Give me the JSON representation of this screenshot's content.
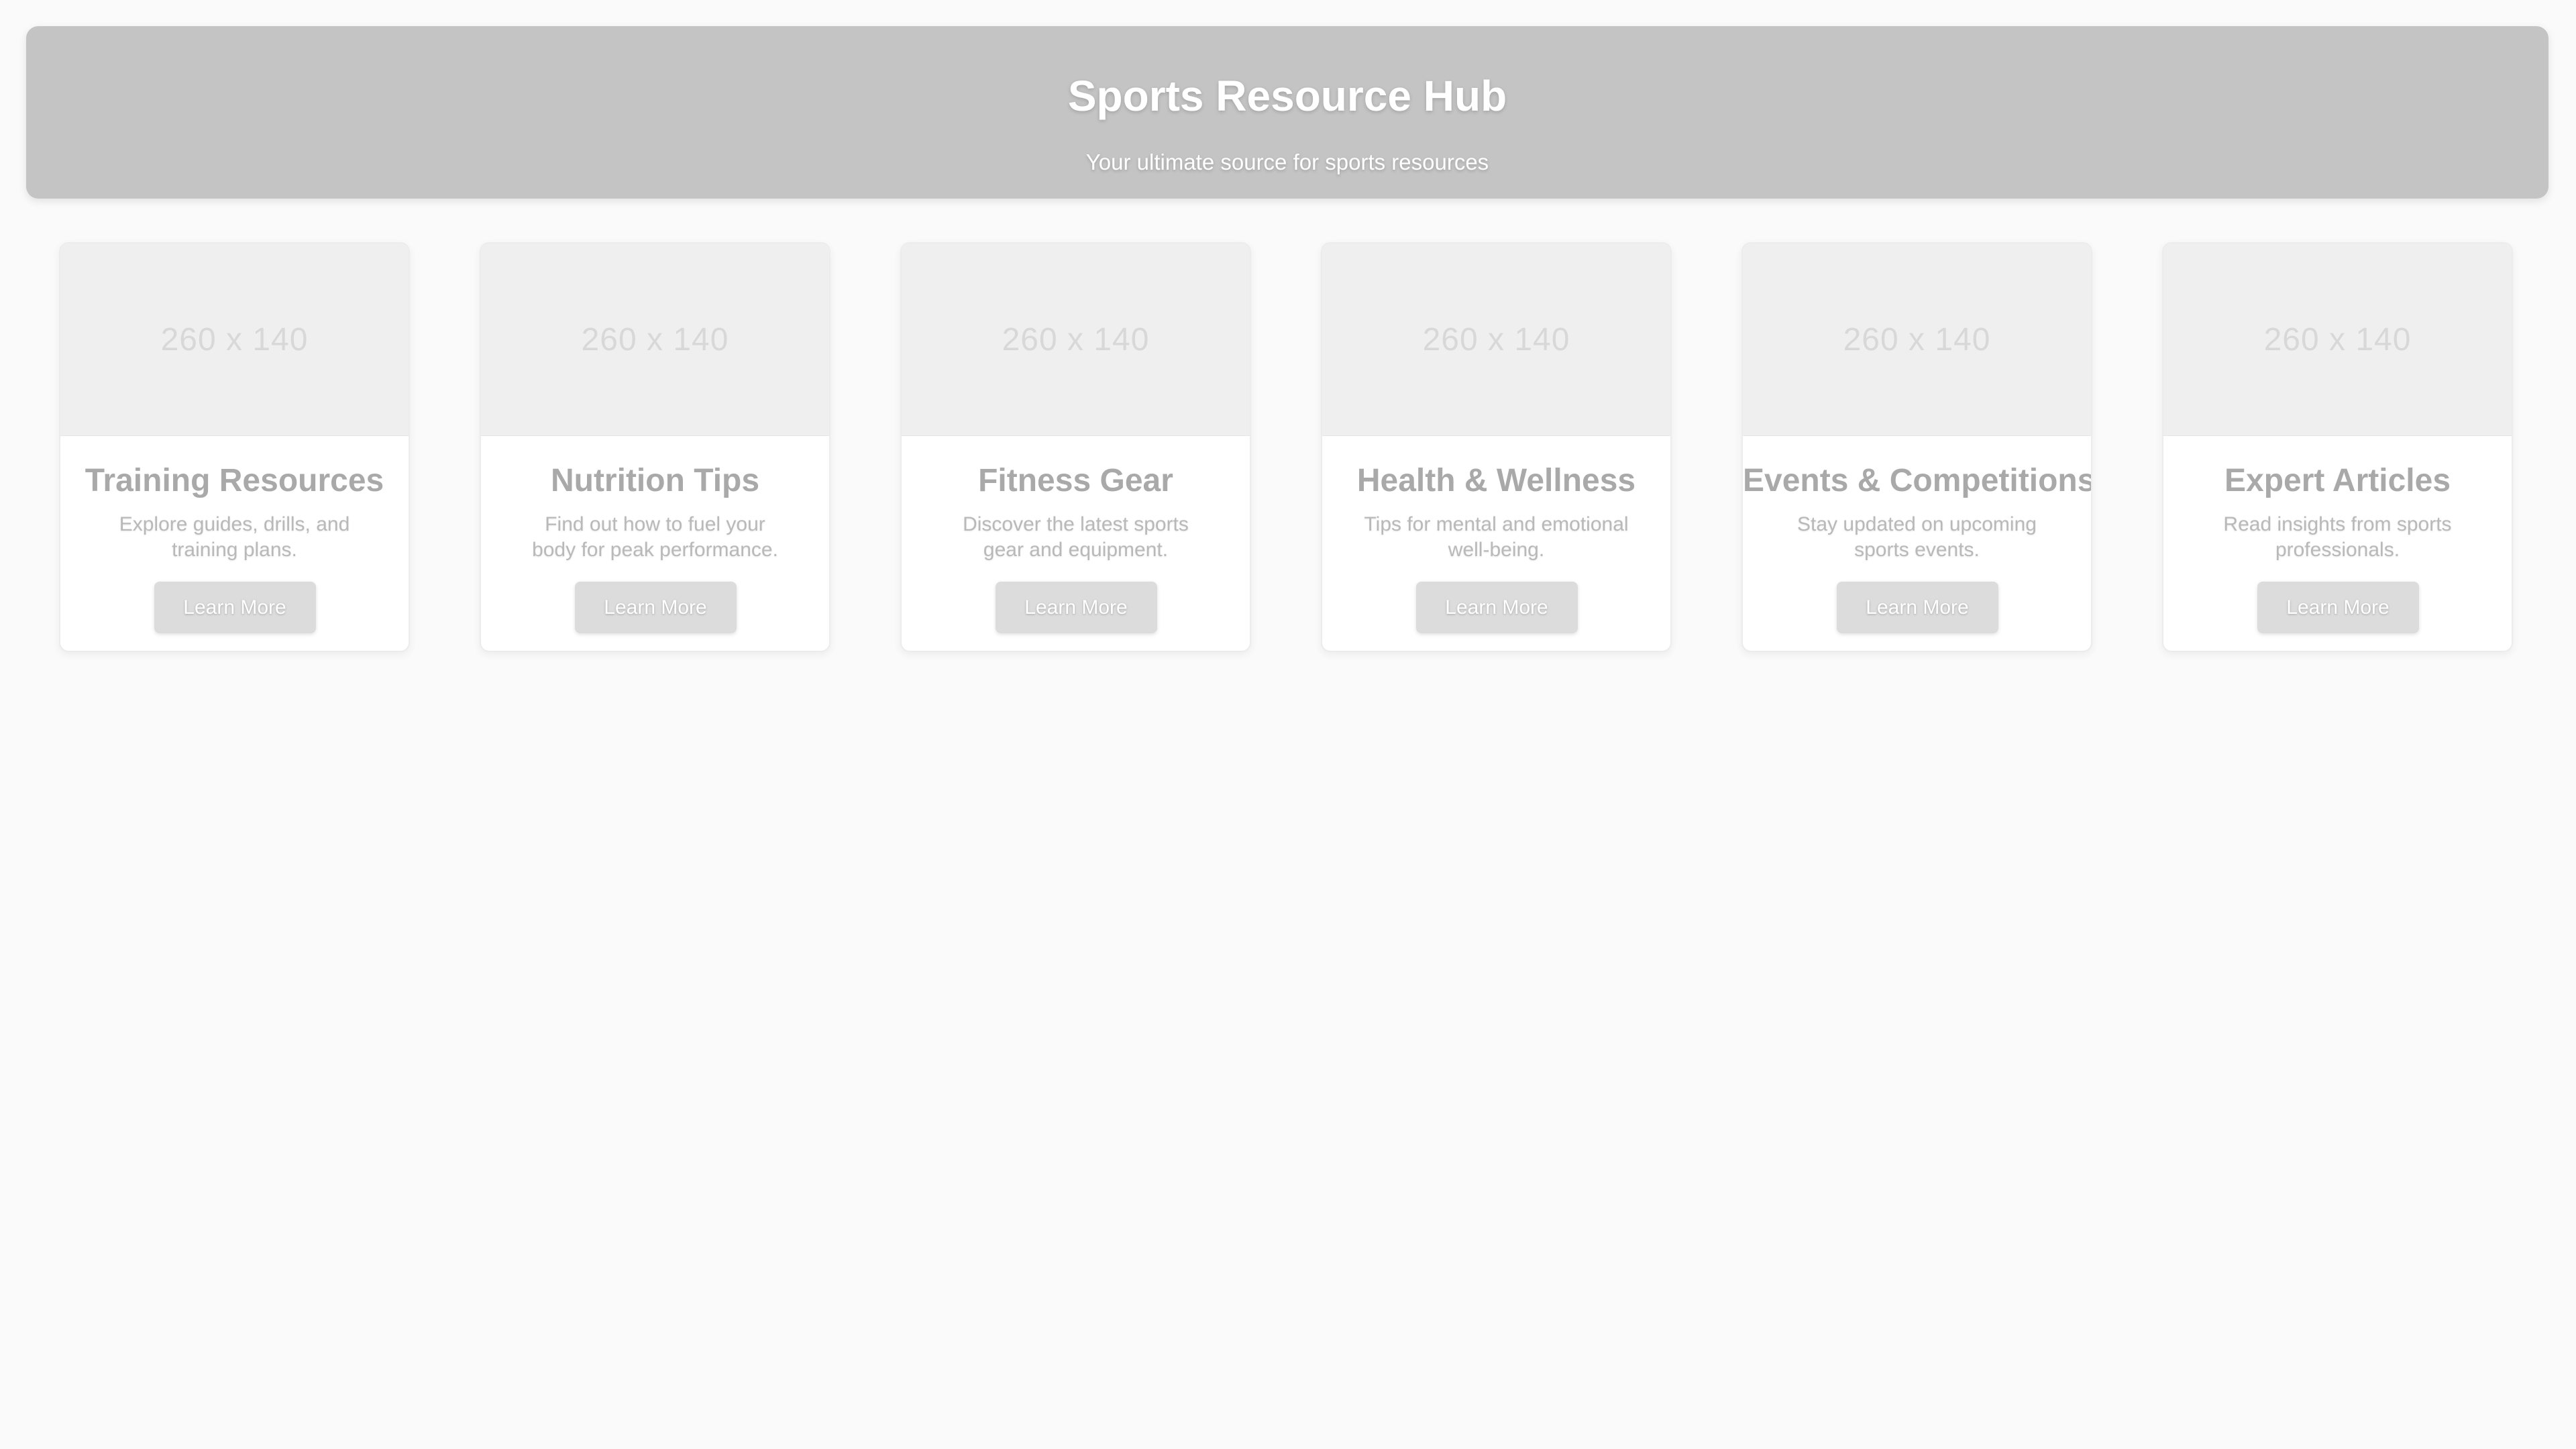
{
  "header": {
    "title": "Sports Resource Hub",
    "subtitle": "Your ultimate source for sports resources"
  },
  "cards": [
    {
      "image_label": "260 x 140",
      "title": "Training Resources",
      "description": "Explore guides, drills, and training plans.",
      "button_label": "Learn More"
    },
    {
      "image_label": "260 x 140",
      "title": "Nutrition Tips",
      "description": "Find out how to fuel your body for peak performance.",
      "button_label": "Learn More"
    },
    {
      "image_label": "260 x 140",
      "title": "Fitness Gear",
      "description": "Discover the latest sports gear and equipment.",
      "button_label": "Learn More"
    },
    {
      "image_label": "260 x 140",
      "title": "Health & Wellness",
      "description": "Tips for mental and emotional well-being.",
      "button_label": "Learn More"
    },
    {
      "image_label": "260 x 140",
      "title": "Events & Competitions",
      "description": "Stay updated on upcoming sports events.",
      "button_label": "Learn More"
    },
    {
      "image_label": "260 x 140",
      "title": "Expert Articles",
      "description": "Read insights from sports professionals.",
      "button_label": "Learn More"
    }
  ]
}
